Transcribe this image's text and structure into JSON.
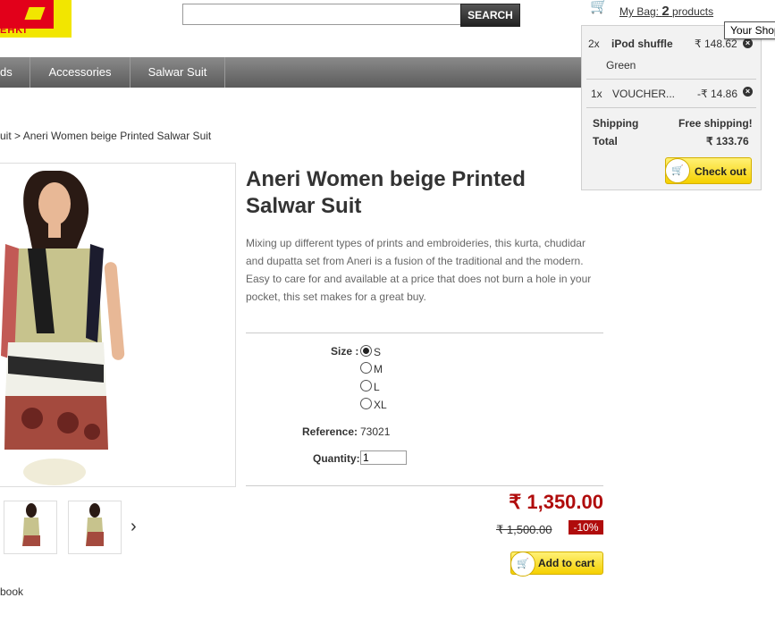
{
  "header": {
    "logo_text": "EHKI",
    "search": {
      "placeholder": "",
      "button_label": "SEARCH"
    },
    "cart": {
      "bag_label": "My Bag:",
      "count": "2",
      "count_suffix": "products"
    },
    "tooltip": "Your Shop"
  },
  "nav": {
    "items": [
      "ds",
      "Accessories",
      "Salwar Suit"
    ]
  },
  "breadcrumb": "uit > Aneri Women beige Printed Salwar Suit",
  "product": {
    "title": "Aneri Women beige Printed Salwar Suit",
    "description": "Mixing up different types of prints and embroideries, this kurta, chudidar and dupatta set from Aneri is a fusion of the traditional and the modern. Easy to care for and available at a price that does not burn a hole in your pocket, this set makes for a great buy.",
    "size_label": "Size :",
    "sizes": [
      "S",
      "M",
      "L",
      "XL"
    ],
    "selected_size": "S",
    "reference_label": "Reference:",
    "reference": "73021",
    "quantity_label": "Quantity:",
    "quantity": "1",
    "price": "₹ 1,350.00",
    "old_price": "₹ 1,500.00",
    "discount": "-10%",
    "add_to_cart": "Add to cart"
  },
  "share": {
    "facebook": "book"
  },
  "cart_dropdown": {
    "items": [
      {
        "qty": "2x",
        "name": "iPod shuffle",
        "price": "₹ 148.62",
        "variant": "Green"
      },
      {
        "qty": "1x",
        "name": "VOUCHER...",
        "price": "-₹ 14.86"
      }
    ],
    "shipping_label": "Shipping",
    "shipping_value": "Free shipping!",
    "total_label": "Total",
    "total_value": "₹ 133.76",
    "checkout": "Check out"
  }
}
